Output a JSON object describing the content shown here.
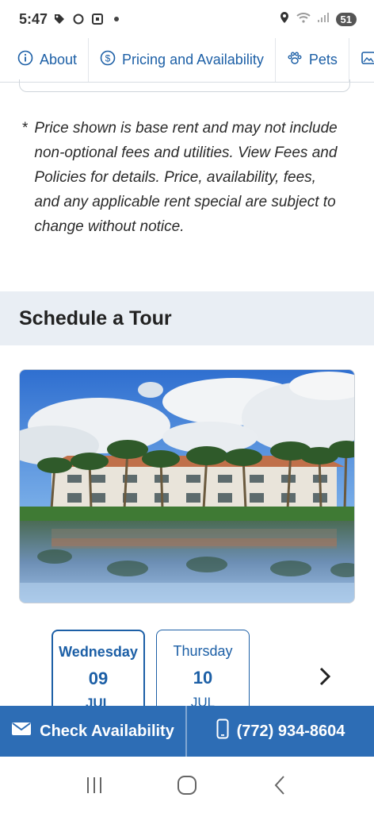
{
  "status_bar": {
    "time": "5:47",
    "battery_level": "51",
    "icons": [
      "tag-icon",
      "sync-icon",
      "screenshot-icon",
      "dot-icon",
      "location-icon",
      "wifi-icon",
      "signal-icon"
    ]
  },
  "tabs": [
    {
      "label": "About",
      "icon": "info-icon"
    },
    {
      "label": "Pricing and Availability",
      "icon": "dollar-icon"
    },
    {
      "label": "Pets",
      "icon": "paw-icon"
    },
    {
      "label": "",
      "icon": "image-icon"
    }
  ],
  "disclaimer": {
    "bullet": "*",
    "text": "Price shown is base rent and may not include non-optional fees and utilities. View Fees and Policies for details. Price, availability, fees, and any applicable rent special are subject to change without notice."
  },
  "section": {
    "title": "Schedule a Tour"
  },
  "photo": {
    "icon": "property-photo"
  },
  "dates": [
    {
      "dow": "Wednesday",
      "day": "09",
      "month": "JUL",
      "selected": true
    },
    {
      "dow": "Thursday",
      "day": "10",
      "month": "JUL",
      "selected": false
    }
  ],
  "cta": {
    "check_availability": "Check Availability",
    "phone": "(772) 934-8604"
  },
  "colors": {
    "accent": "#1c5fa6",
    "cta_bg": "#2d6db5",
    "band_bg": "#e9eef4"
  },
  "nav_bar": {
    "icons": [
      "recents-icon",
      "home-icon",
      "back-icon"
    ]
  }
}
